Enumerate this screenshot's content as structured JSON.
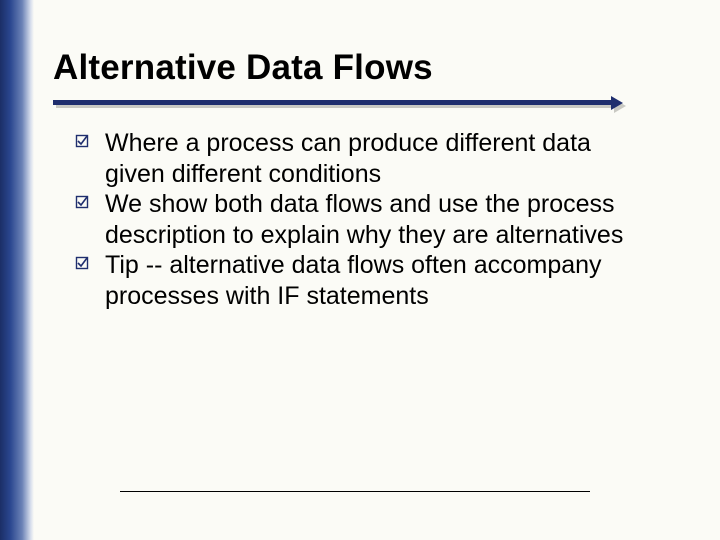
{
  "title": "Alternative Data Flows",
  "bullets": [
    "Where a process can produce different data given different conditions",
    "We show both data flows and use the process description to explain why they are alternatives",
    "Tip -- alternative data flows often accompany processes with IF statements"
  ]
}
